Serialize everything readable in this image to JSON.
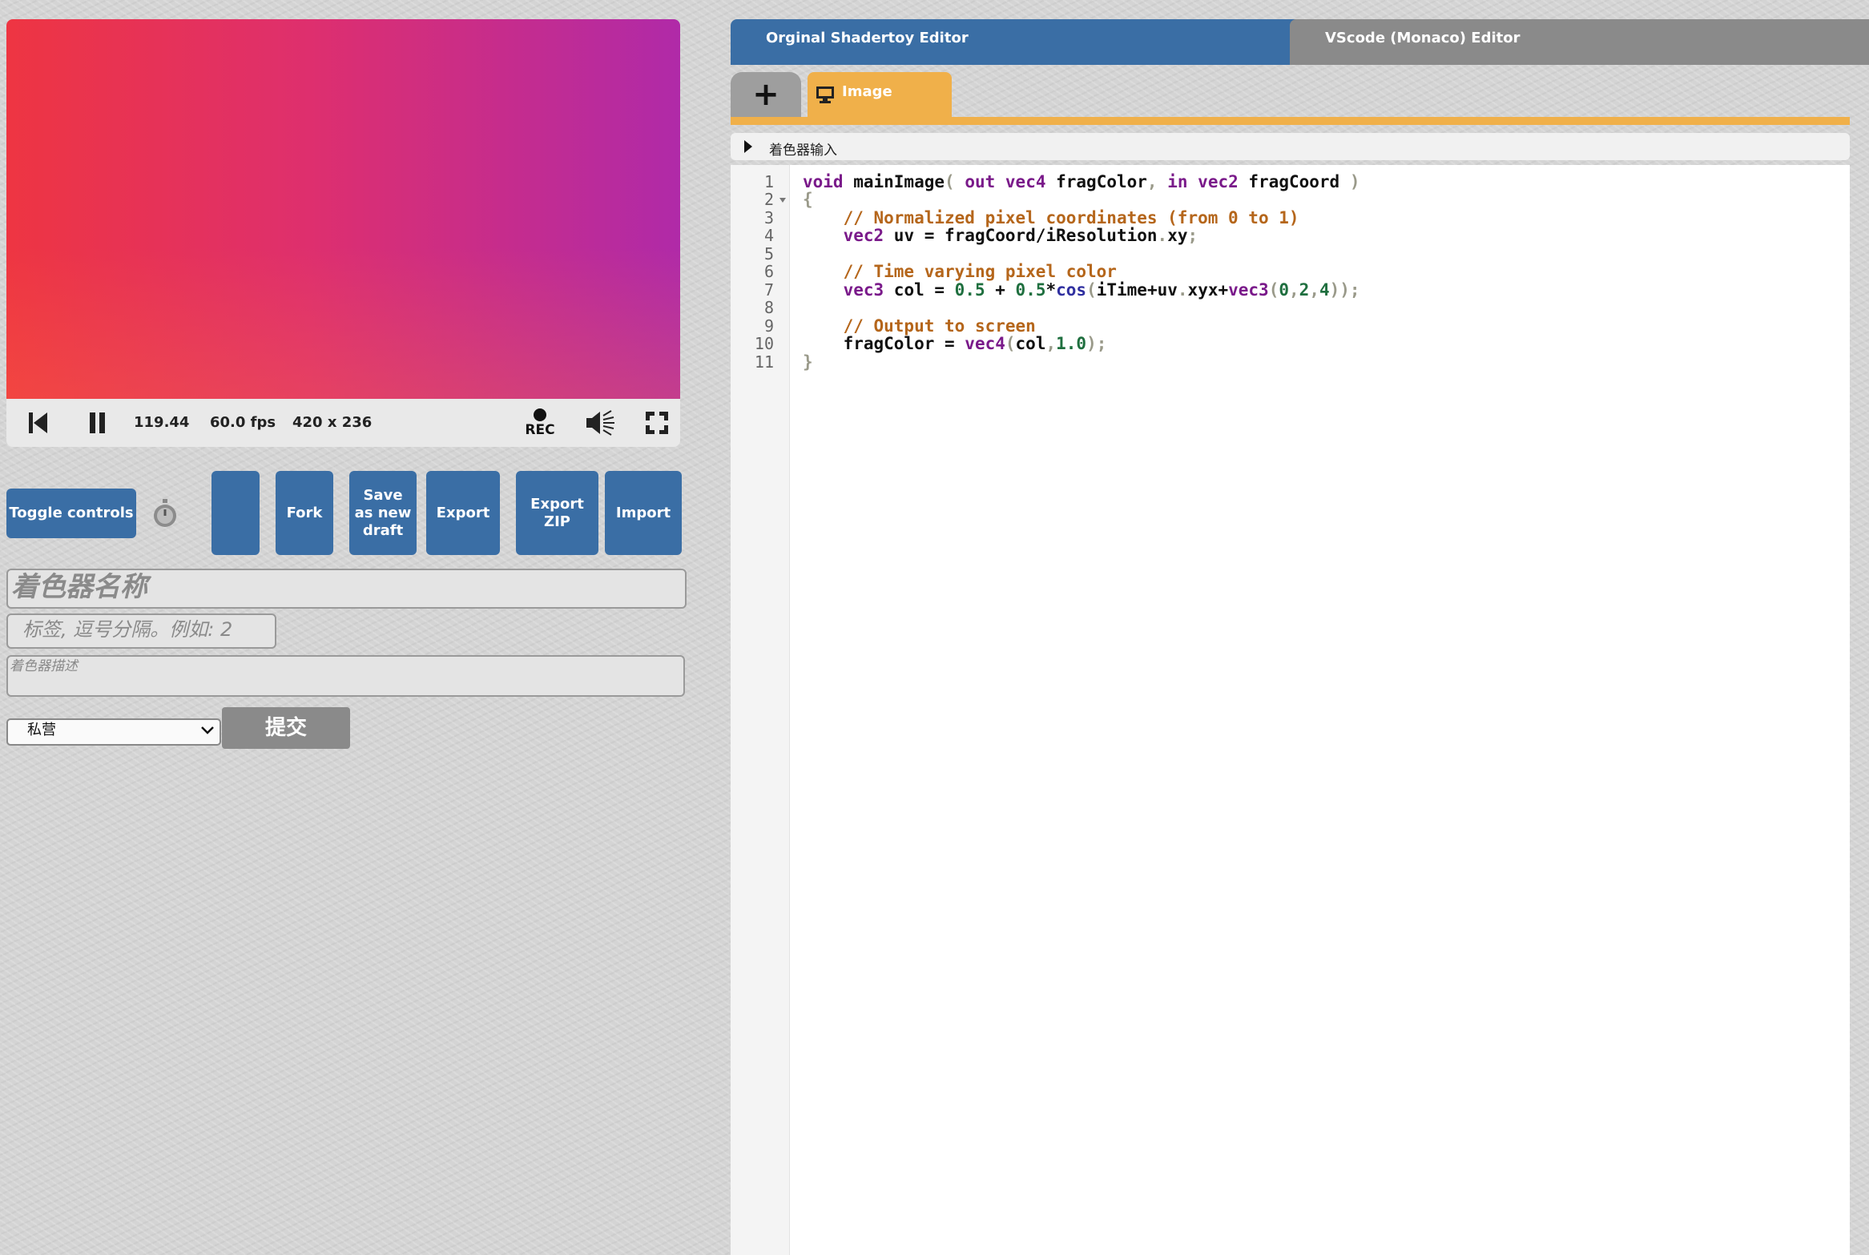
{
  "player": {
    "time": "119.44",
    "fps": "60.0 fps",
    "resolution": "420 x 236",
    "rec_label": "REC"
  },
  "actions": {
    "toggle_controls": "Toggle controls",
    "fork": "Fork",
    "save_as_new_draft": "Save as new draft",
    "export": "Export",
    "export_zip": "Export ZIP",
    "import": "Import"
  },
  "form": {
    "name_placeholder": "着色器名称",
    "tags_placeholder": "标签, 逗号分隔。例如: 2",
    "description_placeholder": "着色器描述",
    "visibility_value": "私营",
    "submit_label": "提交"
  },
  "editor": {
    "tabs": [
      "Orginal Shadertoy Editor",
      "VScode (Monaco) Editor"
    ],
    "add_tab_label": "+",
    "pass_tab_label": "Image",
    "inputs_label": "着色器输入",
    "line_numbers": [
      "1",
      "2",
      "3",
      "4",
      "5",
      "6",
      "7",
      "8",
      "9",
      "10",
      "11"
    ]
  },
  "colors": {
    "button_blue": "#3a6ea5",
    "active_tab": "#3a6ea5",
    "inactive_tab": "#8a8a8a",
    "image_tab_orange": "#f0b04a"
  }
}
